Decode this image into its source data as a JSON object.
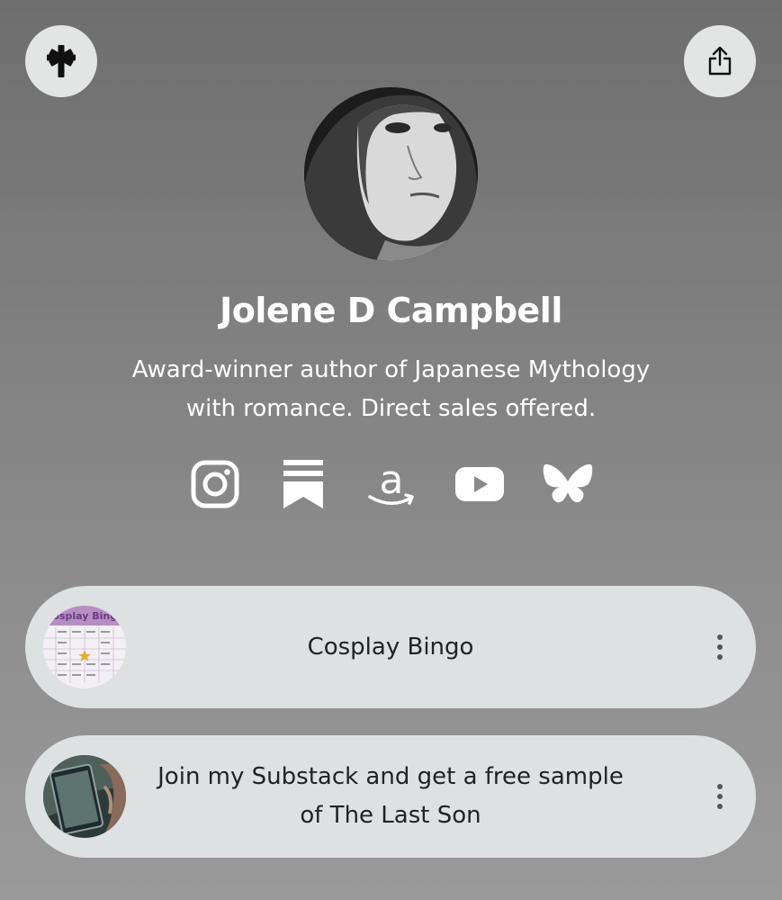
{
  "profile": {
    "name": "Jolene D Campbell",
    "bio_lines": [
      "Award-winner author of Japanese Mythology",
      "with romance. Direct sales offered."
    ]
  },
  "header": {
    "left_icon": "linktree-asterisk-icon",
    "right_icon": "share-icon"
  },
  "socials": [
    {
      "icon": "instagram-icon"
    },
    {
      "icon": "substack-icon"
    },
    {
      "icon": "amazon-icon"
    },
    {
      "icon": "youtube-icon"
    },
    {
      "icon": "bluesky-icon"
    }
  ],
  "links": [
    {
      "lines": [
        "Cosplay Bingo"
      ],
      "thumb_title": "Cosplay Bingo"
    },
    {
      "lines": [
        "Join my Substack and get a free sample",
        "of The Last Son"
      ]
    }
  ],
  "colors": {
    "card_bg": "#dde1e2",
    "button_bg": "#e3e5e5",
    "text_light": "#ffffff",
    "text_dark": "#222222"
  }
}
